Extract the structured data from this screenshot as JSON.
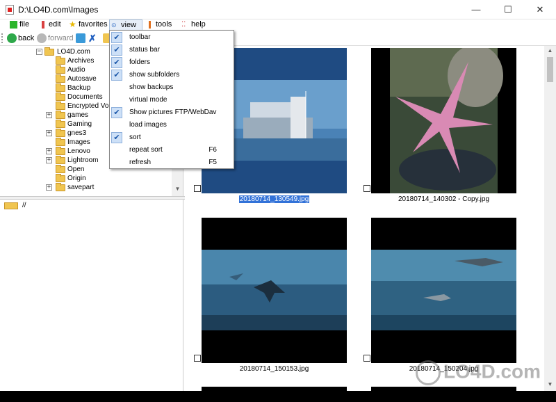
{
  "window": {
    "title": "D:\\LO4D.com\\Images",
    "minimize": "—",
    "maximize": "☐",
    "close": "✕"
  },
  "menubar": [
    {
      "label": "file",
      "icon": "file-icon"
    },
    {
      "label": "edit",
      "icon": "edit-icon"
    },
    {
      "label": "favorites",
      "icon": "star-icon"
    },
    {
      "label": "view",
      "icon": "view-icon"
    },
    {
      "label": "tools",
      "icon": "tools-icon"
    },
    {
      "label": "help",
      "icon": "help-icon"
    }
  ],
  "toolbar": {
    "back": "back",
    "forward": "forward"
  },
  "tree": {
    "root": "LO4D.com",
    "items": [
      {
        "label": "Archives",
        "expandable": false
      },
      {
        "label": "Audio",
        "expandable": false
      },
      {
        "label": "Autosave",
        "expandable": false
      },
      {
        "label": "Backup",
        "expandable": false
      },
      {
        "label": "Documents",
        "expandable": false
      },
      {
        "label": "Encrypted Volu",
        "expandable": false
      },
      {
        "label": "games",
        "expandable": true
      },
      {
        "label": "Gaming",
        "expandable": false
      },
      {
        "label": "gnes3",
        "expandable": true
      },
      {
        "label": "Images",
        "expandable": false
      },
      {
        "label": "Lenovo",
        "expandable": true
      },
      {
        "label": "Lightroom",
        "expandable": true
      },
      {
        "label": "Open",
        "expandable": false
      },
      {
        "label": "Origin",
        "expandable": false
      },
      {
        "label": "savepart",
        "expandable": true
      }
    ]
  },
  "file_list": {
    "path": "//"
  },
  "view_menu": [
    {
      "label": "toolbar",
      "checked": true,
      "shortcut": ""
    },
    {
      "label": "status bar",
      "checked": true,
      "shortcut": ""
    },
    {
      "label": "folders",
      "checked": true,
      "shortcut": ""
    },
    {
      "label": "show subfolders",
      "checked": true,
      "shortcut": ""
    },
    {
      "label": "show backups",
      "checked": false,
      "shortcut": ""
    },
    {
      "label": "virtual mode",
      "checked": false,
      "shortcut": ""
    },
    {
      "label": "Show pictures FTP/WebDav",
      "checked": true,
      "shortcut": ""
    },
    {
      "label": "load images",
      "checked": false,
      "shortcut": ""
    },
    {
      "label": "sort",
      "checked": true,
      "shortcut": ""
    },
    {
      "label": "repeat sort",
      "checked": false,
      "shortcut": "F6"
    },
    {
      "label": "refresh",
      "checked": false,
      "shortcut": "F5"
    }
  ],
  "gallery": [
    {
      "caption": "20180714_130549.jpg",
      "selected": true
    },
    {
      "caption": "20180714_140302 - Copy.jpg",
      "selected": false
    },
    {
      "caption": "20180714_150153.jpg",
      "selected": false
    },
    {
      "caption": "20180714_150204.jpg",
      "selected": false
    }
  ],
  "colors": {
    "selection": "#3272d8",
    "menu_highlight": "#e6eef8",
    "check_bg": "#cde0f7"
  },
  "watermark": "LO4D.com"
}
